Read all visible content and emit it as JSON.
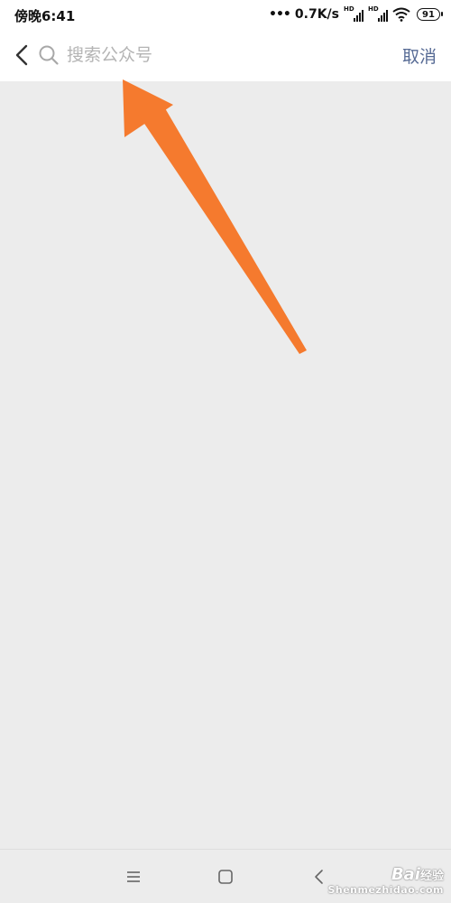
{
  "status_bar": {
    "time": "傍晚6:41",
    "dots": "•••",
    "net_speed": "0.7K/s",
    "sim1_label": "HD",
    "sim2_label": "HD",
    "battery": "91"
  },
  "search": {
    "placeholder": "搜索公众号",
    "value": "",
    "cancel_label": "取消"
  },
  "annotation": {
    "color": "#f57a2e"
  },
  "nav_bar": {
    "menu_icon": "menu-icon",
    "home_icon": "home-icon",
    "back_icon": "back-icon"
  },
  "watermark": {
    "brand": "Bai",
    "brand_suffix": "经验",
    "url": "Shenmezhidao.com"
  },
  "colors": {
    "background": "#ececec",
    "header": "#ffffff",
    "accent": "#576b95",
    "placeholder": "#b4b4b4"
  }
}
